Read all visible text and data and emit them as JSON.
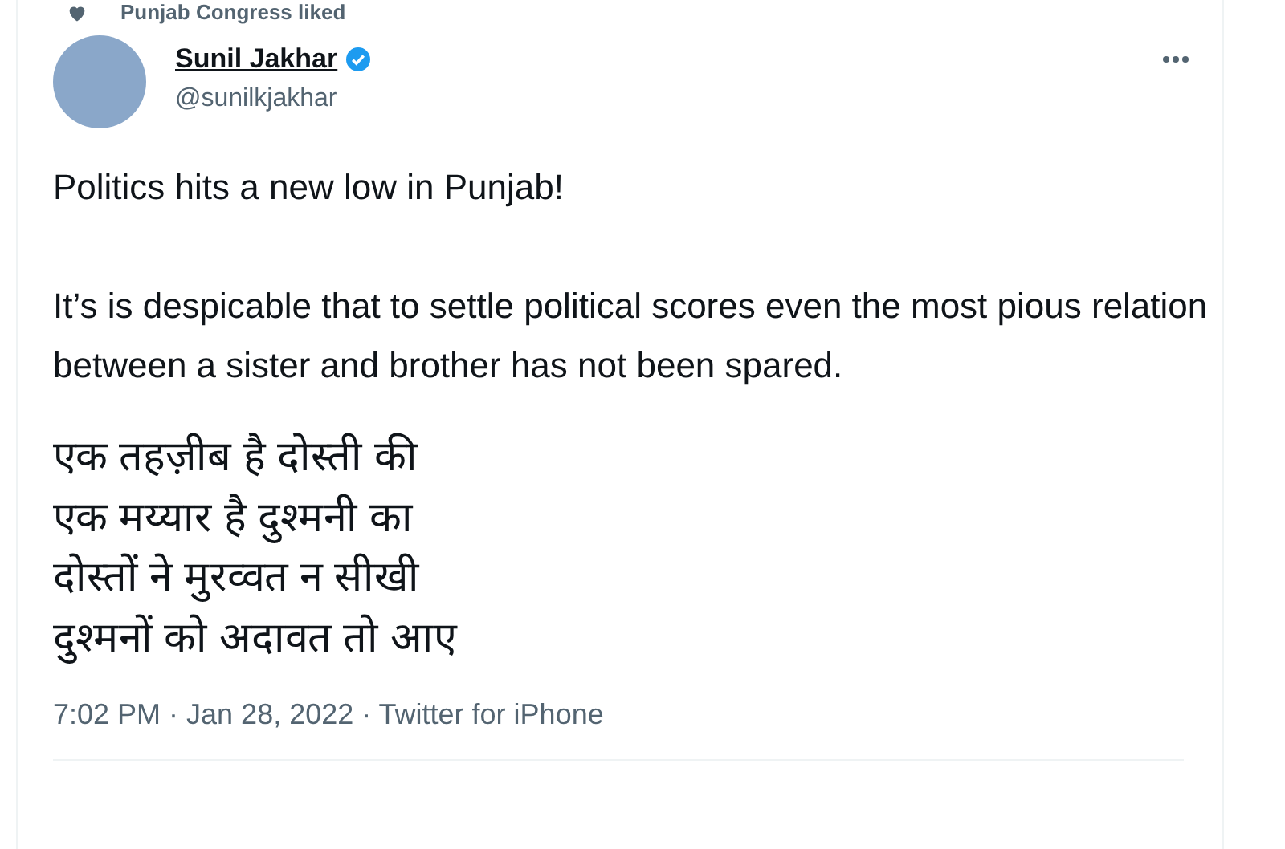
{
  "social_context": {
    "text": "Punjab Congress liked"
  },
  "author": {
    "name": "Sunil Jakhar",
    "handle": "@sunilkjakhar",
    "verified": true
  },
  "tweet": {
    "paragraphs": [
      "Politics hits a new low in Punjab!",
      "It’s is despicable that to settle political scores even the most pious relation between a sister and brother has not been spared."
    ],
    "verse": [
      "एक तहज़ीब है दोस्ती की",
      "एक मय्यार है दुश्मनी का",
      "दोस्तों ने मुरव्वत न सीखी",
      "दुश्मनों को अदावत तो आए"
    ]
  },
  "meta": "7:02 PM · Jan 28, 2022 · Twitter for iPhone"
}
